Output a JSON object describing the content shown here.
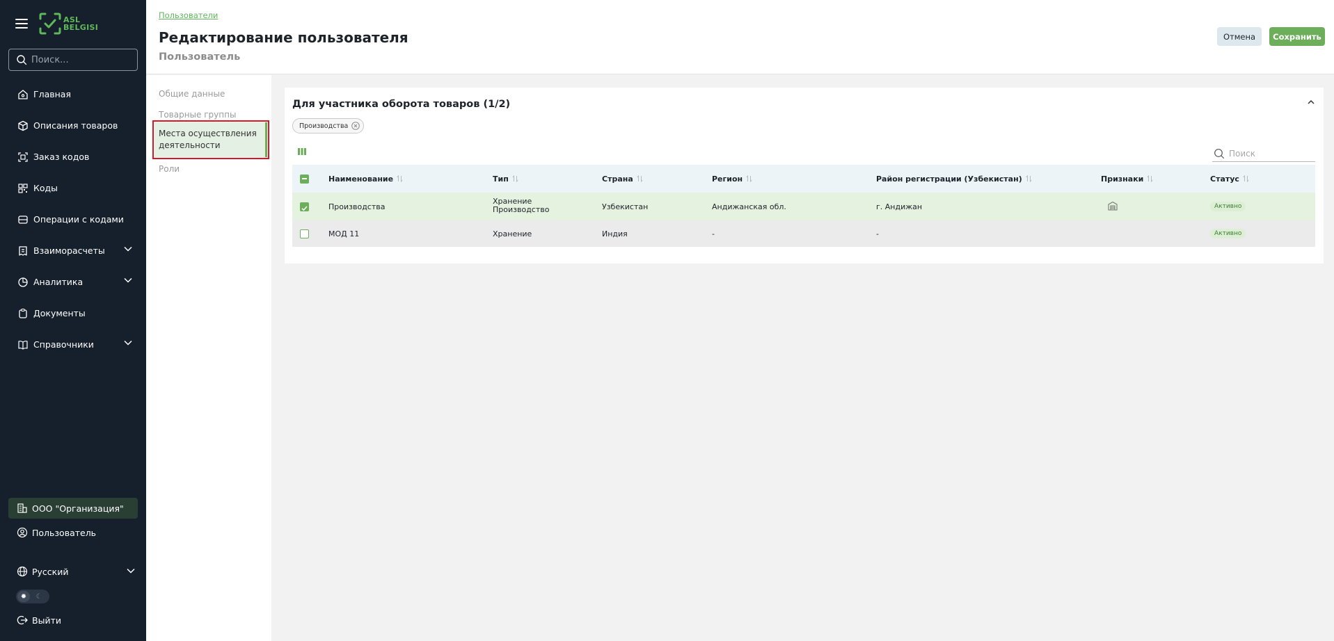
{
  "sidebar": {
    "logo_line1": "ASL",
    "logo_line2": "BELGISI",
    "search_placeholder": "Поиск...",
    "items": [
      {
        "label": "Главная",
        "icon": "home-icon"
      },
      {
        "label": "Описания товаров",
        "icon": "box-icon"
      },
      {
        "label": "Заказ кодов",
        "icon": "code-order-icon"
      },
      {
        "label": "Коды",
        "icon": "codes-icon"
      },
      {
        "label": "Операции с кодами",
        "icon": "operations-icon"
      },
      {
        "label": "Взаиморасчеты",
        "icon": "settlements-icon",
        "expandable": true
      },
      {
        "label": "Аналитика",
        "icon": "analytics-icon",
        "expandable": true
      },
      {
        "label": "Документы",
        "icon": "documents-icon"
      },
      {
        "label": "Справочники",
        "icon": "book-icon",
        "expandable": true
      }
    ],
    "organization": "ООО \"Организация\"",
    "user": "Пользователь",
    "language": "Русский",
    "theme": {
      "active": "light"
    },
    "logout": "Выйти"
  },
  "header": {
    "breadcrumb": "Пользователи",
    "title": "Редактирование пользователя",
    "subtitle": "Пользователь",
    "cancel_label": "Отмена",
    "save_label": "Сохранить"
  },
  "subnav": {
    "items": [
      {
        "label": "Общие данные",
        "active": false
      },
      {
        "label": "Товарные группы",
        "active": false
      },
      {
        "label": "Места осуществления деятельности",
        "active": true
      },
      {
        "label": "Роли",
        "active": false
      }
    ]
  },
  "card": {
    "title": "Для участника оборота товаров (1/2)",
    "filter_chip": "Производства",
    "search_placeholder": "Поиск",
    "columns": [
      "Наименование",
      "Тип",
      "Страна",
      "Регион",
      "Район регистрации (Узбекистан)",
      "Признаки",
      "Статус"
    ],
    "rows": [
      {
        "checked": true,
        "name": "Производства",
        "type": [
          "Хранение",
          "Производство"
        ],
        "country": "Узбекистан",
        "region": "Андижанская обл.",
        "district": "г. Андижан",
        "signs_icon": "warehouse-icon",
        "status": "Активно"
      },
      {
        "checked": false,
        "name": "МОД 11",
        "type": [
          "Хранение"
        ],
        "country": "Индия",
        "region": "-",
        "district": "-",
        "signs_icon": "",
        "status": "Активно"
      }
    ]
  },
  "colors": {
    "sidebar_bg": "#16202c",
    "accent_green": "#6cae5a",
    "highlight_red": "#e0141e"
  }
}
